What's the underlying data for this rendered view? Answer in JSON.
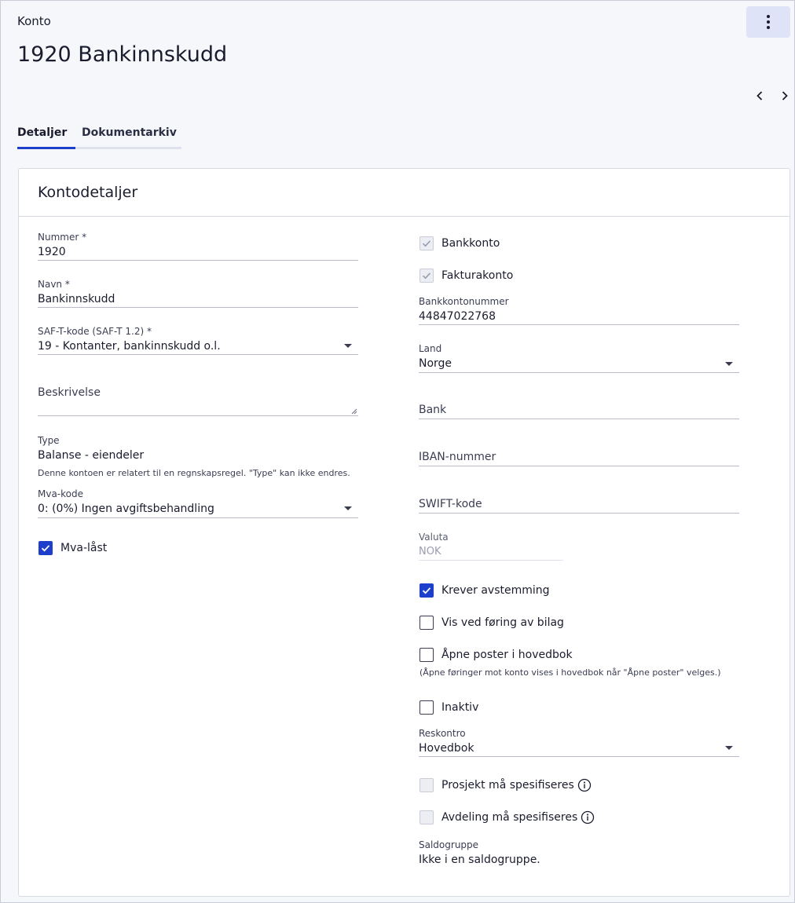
{
  "header": {
    "breadcrumb": "Konto",
    "title": "1920 Bankinnskudd"
  },
  "tabs": [
    {
      "label": "Detaljer"
    },
    {
      "label": "Dokumentarkiv"
    }
  ],
  "card": {
    "title": "Kontodetaljer"
  },
  "left": {
    "nummer": {
      "label": "Nummer *",
      "value": "1920"
    },
    "navn": {
      "label": "Navn *",
      "value": "Bankinnskudd"
    },
    "saft": {
      "label": "SAF-T-kode (SAF-T 1.2) *",
      "value": "19 - Kontanter, bankinnskudd o.l."
    },
    "beskrivelse": {
      "placeholder": "Beskrivelse"
    },
    "type": {
      "label": "Type",
      "value": "Balanse - eiendeler",
      "hint": "Denne kontoen er relatert til en regnskapsregel. \"Type\" kan ikke endres."
    },
    "mva": {
      "label": "Mva-kode",
      "value": "0: (0%) Ingen avgiftsbehandling"
    },
    "mva_last": {
      "label": "Mva-låst"
    }
  },
  "right": {
    "bankkonto": {
      "label": "Bankkonto"
    },
    "fakturakonto": {
      "label": "Fakturakonto"
    },
    "bankkontonummer": {
      "label": "Bankkontonummer",
      "value": "44847022768"
    },
    "land": {
      "label": "Land",
      "value": "Norge"
    },
    "bank": {
      "placeholder": "Bank"
    },
    "iban": {
      "placeholder": "IBAN-nummer"
    },
    "swift": {
      "placeholder": "SWIFT-kode"
    },
    "valuta": {
      "label": "Valuta",
      "value": "NOK"
    },
    "krever": {
      "label": "Krever avstemming"
    },
    "vis": {
      "label": "Vis ved føring av bilag"
    },
    "apne": {
      "label": "Åpne poster i hovedbok",
      "hint": "(Åpne føringer mot konto vises i hovedbok når \"Åpne poster\" velges.)"
    },
    "inaktiv": {
      "label": "Inaktiv"
    },
    "reskontro": {
      "label": "Reskontro",
      "value": "Hovedbok"
    },
    "prosjekt": {
      "label": "Prosjekt må spesifiseres"
    },
    "avdeling": {
      "label": "Avdeling må spesifiseres"
    },
    "saldogruppe": {
      "label": "Saldogruppe",
      "value": "Ikke i en saldogruppe."
    }
  },
  "icons": {
    "menu": "more-vertical-icon",
    "prev": "chevron-left-icon",
    "next": "chevron-right-icon",
    "check": "check-icon",
    "info": "info-icon"
  },
  "colors": {
    "accent": "#1e3fcc",
    "menu_bg": "#dfe3f7"
  }
}
